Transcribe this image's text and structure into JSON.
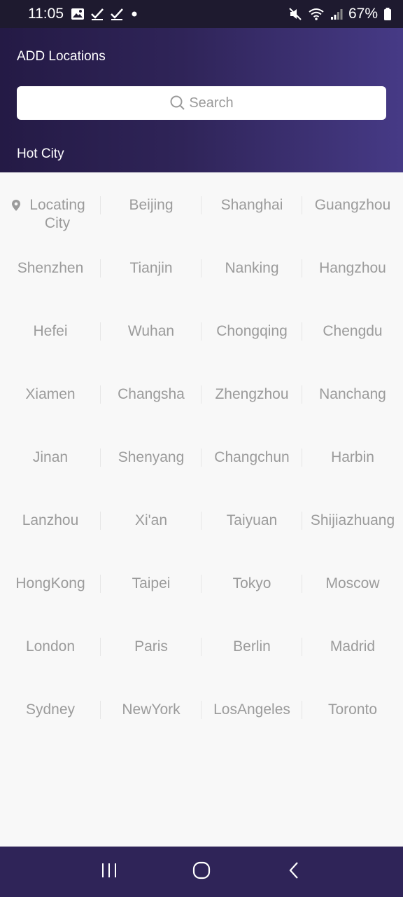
{
  "status": {
    "time": "11:05",
    "battery": "67%"
  },
  "header": {
    "title": "ADD Locations",
    "search_placeholder": "Search",
    "section_title": "Hot City"
  },
  "cities": [
    "Locating City",
    "Beijing",
    "Shanghai",
    "Guangzhou",
    "Shenzhen",
    "Tianjin",
    "Nanking",
    "Hangzhou",
    "Hefei",
    "Wuhan",
    "Chongqing",
    "Chengdu",
    "Xiamen",
    "Changsha",
    "Zhengzhou",
    "Nanchang",
    "Jinan",
    "Shenyang",
    "Changchun",
    "Harbin",
    "Lanzhou",
    "Xi'an",
    "Taiyuan",
    "Shijiazhuang",
    "HongKong",
    "Taipei",
    "Tokyo",
    "Moscow",
    "London",
    "Paris",
    "Berlin",
    "Madrid",
    "Sydney",
    "NewYork",
    "LosAngeles",
    "Toronto"
  ],
  "icons": {
    "locating": "map-pin-icon",
    "search": "search-icon",
    "nav_recent": "recent-apps-icon",
    "nav_home": "home-icon",
    "nav_back": "back-icon"
  },
  "colors": {
    "header_gradient_start": "#241a45",
    "header_gradient_end": "#463a86",
    "city_text": "#9b9b9b",
    "nav_bar": "#2f2458"
  }
}
